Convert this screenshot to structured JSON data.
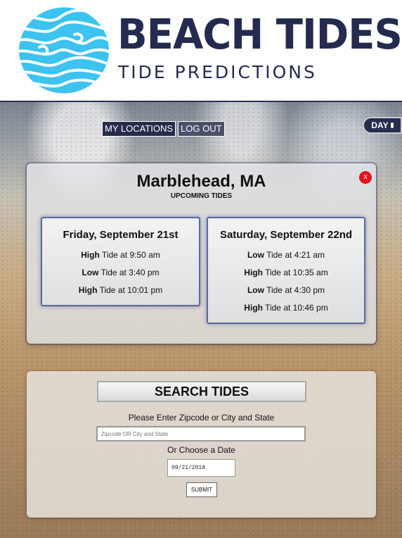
{
  "brand": {
    "title": "BEACH TIDES",
    "subtitle": "TIDE PREDICTIONS"
  },
  "nav": {
    "my_locations": "MY LOCATIONS",
    "log_out": "LOG OUT",
    "day_toggle": "DAY"
  },
  "tides_panel": {
    "location": "Marblehead, MA",
    "subtitle": "UPCOMING TIDES",
    "close": "x",
    "days": [
      {
        "date": "Friday, September 21st",
        "tides": [
          {
            "type": "High",
            "rest": " Tide at 9:50 am"
          },
          {
            "type": "Low",
            "rest": " Tide at 3:40 pm"
          },
          {
            "type": "High",
            "rest": " Tide at 10:01 pm"
          }
        ]
      },
      {
        "date": "Saturday, September 22nd",
        "tides": [
          {
            "type": "Low",
            "rest": " Tide at 4:21 am"
          },
          {
            "type": "High",
            "rest": " Tide at 10:35 am"
          },
          {
            "type": "Low",
            "rest": " Tide at 4:30 pm"
          },
          {
            "type": "High",
            "rest": " Tide at 10:46 pm"
          }
        ]
      }
    ]
  },
  "search": {
    "title": "SEARCH TIDES",
    "prompt": "Please Enter Zipcode or City and State",
    "placeholder": "Zipcode OR City and State",
    "date_prompt": "Or Choose a Date",
    "date_value": "09/21/2018",
    "submit": "SUBMIT"
  },
  "colors": {
    "brand_navy": "#252b4f",
    "logo_cyan": "#3cc3f0",
    "close_red": "#e3161b"
  }
}
